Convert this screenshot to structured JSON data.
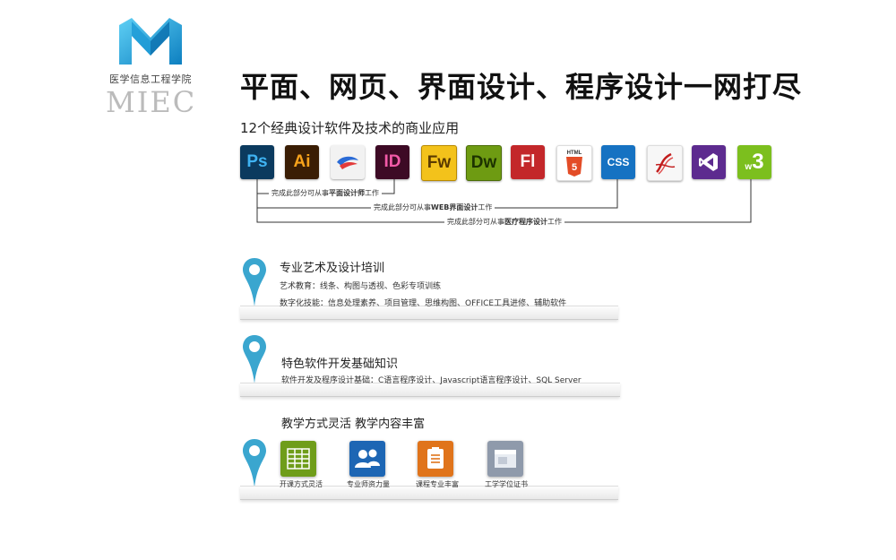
{
  "logo": {
    "cn": "医学信息工程学院",
    "en": "MIEC"
  },
  "title": "平面、网页、界面设计、程序设计一网打尽",
  "subtitle": "12个经典设计软件及技术的商业应用",
  "colors": {
    "brand": "#1aa3d6",
    "pin": "#3aa6cf"
  },
  "software_icons": [
    {
      "name": "photoshop-icon",
      "label": "Ps"
    },
    {
      "name": "illustrator-icon",
      "label": "Ai"
    },
    {
      "name": "coreldraw-icon",
      "label": ""
    },
    {
      "name": "indesign-icon",
      "label": "ID"
    },
    {
      "name": "fireworks-icon",
      "label": "Fw"
    },
    {
      "name": "dreamweaver-icon",
      "label": "Dw"
    },
    {
      "name": "flash-icon",
      "label": "Fl"
    },
    {
      "name": "html5-icon",
      "label": "HTML"
    },
    {
      "name": "css-icon",
      "label": "CSS"
    },
    {
      "name": "sql-server-icon",
      "label": ""
    },
    {
      "name": "visual-studio-icon",
      "label": ""
    },
    {
      "name": "w3-icon",
      "label": "3"
    }
  ],
  "brackets": {
    "b1_pre": "完成此部分可从事",
    "b1_bold": "平面设计师",
    "b1_post": "工作",
    "b2_pre": "完成此部分可从事",
    "b2_bold": "WEB界面设计",
    "b2_post": "工作",
    "b3_pre": "完成此部分可从事",
    "b3_bold": "医疗程序设计",
    "b3_post": "工作"
  },
  "section1": {
    "heading": "专业艺术及设计培训",
    "line1": "艺术教育：线条、构图与透视、色彩专项训练",
    "line2": "数字化技能：信息处理素养、项目管理、思维构图、OFFICE工具进修、辅助软件"
  },
  "section2": {
    "heading": "特色软件开发基础知识",
    "line1": "软件开发及程序设计基础：C语言程序设计、Javascript语言程序设计、SQL Server"
  },
  "section3": {
    "heading": "教学方式灵活  教学内容丰富",
    "features": [
      {
        "name": "flexible-class-icon",
        "label": "开课方式灵活"
      },
      {
        "name": "faculty-icon",
        "label": "专业师资力量"
      },
      {
        "name": "course-icon",
        "label": "课程专业丰富"
      },
      {
        "name": "certificate-icon",
        "label": "工学学位证书"
      }
    ]
  }
}
